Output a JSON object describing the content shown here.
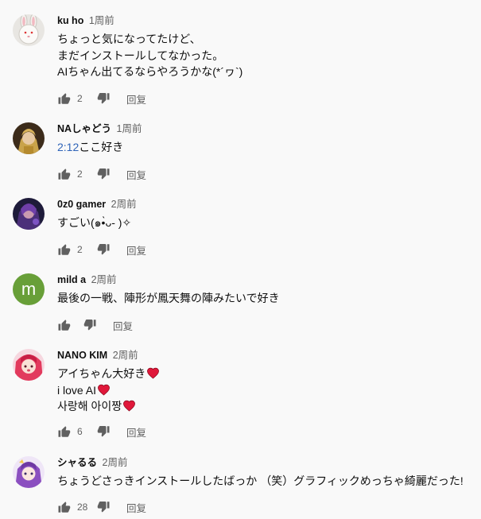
{
  "comments": [
    {
      "author": "ku ho",
      "time": "1周前",
      "lines": [
        "ちょっと気になってたけど、",
        "まだインストールしてなかった。",
        "AIちゃん出てるならやろうかな(*´ヮ`)"
      ],
      "likes": "2",
      "reply": "回复",
      "avatar": "rabbit"
    },
    {
      "author": "NAしゃどう",
      "time": "1周前",
      "timestamp_link": "2:12",
      "text": "ここ好き",
      "likes": "2",
      "reply": "回复",
      "avatar": "gold-character"
    },
    {
      "author": "0z0 gamer",
      "time": "2周前",
      "text": "すごい(๑•̀ᴗ- )✧",
      "likes": "2",
      "reply": "回复",
      "avatar": "dark-character"
    },
    {
      "author": "mild a",
      "time": "2周前",
      "text": "最後の一戦、陣形が鳳天舞の陣みたいで好き",
      "likes": "",
      "reply": "回复",
      "avatar_letter": "m"
    },
    {
      "author": "NANO KIM",
      "time": "2周前",
      "lines": [
        "アイちゃん大好き",
        "i love AI",
        "사랑해 아이짱"
      ],
      "likes": "6",
      "reply": "回复",
      "avatar": "pink-character"
    },
    {
      "author": "シャるる",
      "time": "2周前",
      "text": "ちょうどさっきインストールしたばっか （笑）グラフィックめっちゃ綺麗だった!",
      "likes": "28",
      "reply": "回复",
      "avatar": "purple-character"
    }
  ],
  "icons": {
    "like": "thumb-up-icon",
    "dislike": "thumb-down-icon",
    "heart": "heart-icon"
  },
  "colors": {
    "link": "#2f64b8",
    "heart": "#e0183a",
    "letter_avatar": "#689f38"
  }
}
